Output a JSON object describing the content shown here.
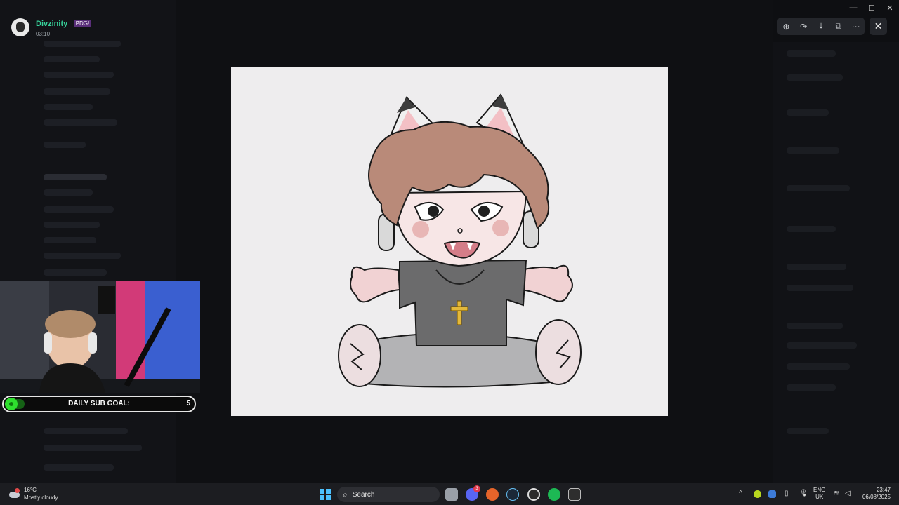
{
  "viewer": {
    "username": "Divzinity",
    "badge": "PDG!",
    "time": "03:10"
  },
  "toolbar": {
    "zoom_icon": "⊕",
    "forward_icon": "↷",
    "download_icon": "⤓",
    "open_icon": "⧉",
    "more_icon": "⋯",
    "close_icon": "✕"
  },
  "window": {
    "minimize": "—",
    "maximize": "☐",
    "close": "✕"
  },
  "overlay": {
    "subgoal_label": "DAILY SUB GOAL:",
    "subgoal_count": "5"
  },
  "taskbar": {
    "temperature": "16°C",
    "weather": "Mostly cloudy",
    "search_placeholder": "Search",
    "lang_1": "ENG",
    "lang_2": "UK",
    "time": "23:47",
    "date": "06/08/2025",
    "notification_badge": "3"
  },
  "colors": {
    "accent_green": "#37d39b",
    "windows_blue": "#4cc2ff",
    "discord": "#5865f2",
    "spotify": "#1db954"
  }
}
